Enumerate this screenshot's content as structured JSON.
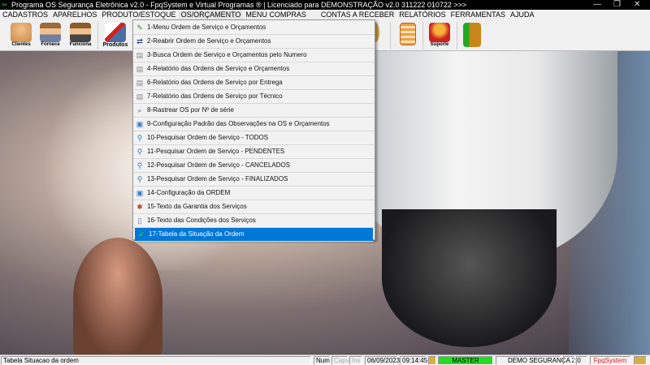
{
  "window": {
    "title": "Programa OS Segurança Eletrônica v2.0 - FpqSystem e Virtual Programas ® | Licenciado para  DEMONSTRAÇÃO v2.0 311222 010722 >>>",
    "minimize": "—",
    "maximize": "❐",
    "close": "✕"
  },
  "menubar": [
    "CADASTROS",
    "APARELHOS",
    "PRODUTO/ESTOQUE",
    "OS/ORÇAMENTO",
    "MENU COMPRAS",
    "CONTAS A RECEBER",
    "RELATÓRIOS",
    "FERRAMENTAS",
    "AJUDA"
  ],
  "toolbar": {
    "clientes": "Clientes",
    "fornece": "Fornece",
    "funciona": "Funciona",
    "produtos": "Produtos",
    "suporte": "Suporte"
  },
  "os_menu": [
    {
      "label": "1-Menu Ordem de Serviço e Orçamentos",
      "icon": "edit-check-icon"
    },
    {
      "label": "2-Reabrir Ordem de Serviço e Orçamentos",
      "icon": "swap-arrows-icon"
    },
    {
      "label": "3-Busca Ordem de Serviço e Orçamentos pelo Numero",
      "icon": "printer-icon"
    },
    {
      "label": "4-Relatório das Ordens de Serviço e Orçamentos",
      "icon": "printer-icon"
    },
    {
      "label": "6-Relatório das Ordens de Serviço por Entrega",
      "icon": "printer-icon"
    },
    {
      "label": "7-Relatório das Ordens de Serviço por Técnico",
      "icon": "printer-icon"
    },
    {
      "label": "8-Rastrear OS por Nº de série",
      "icon": "track-search-icon"
    },
    {
      "label": "9-Configuração Padrão das Observações na OS e Orçamentos",
      "icon": "config-window-icon"
    },
    {
      "label": "10-Pesquisar Ordem de Serviço - TODOS",
      "icon": "magnifier-icon"
    },
    {
      "label": "11-Pesquisar Ordem de Serviço - PENDENTES",
      "icon": "magnifier-icon"
    },
    {
      "label": "12-Pesquisar Ordem de Serviço - CANCELADOS",
      "icon": "magnifier-icon"
    },
    {
      "label": "13-Pesquisar Ordem de Serviço - FINALIZADOS",
      "icon": "magnifier-icon"
    },
    {
      "label": "14-Configuração da ORDEM",
      "icon": "config-window-icon"
    },
    {
      "label": "15-Texto da Garantia dos Serviços",
      "icon": "document-star-icon"
    },
    {
      "label": "16-Texto das Condições dos Serviços",
      "icon": "document-icon"
    },
    {
      "label": "17-Tabela da Situação da Ordem",
      "icon": "check-icon",
      "selected": true
    }
  ],
  "status": {
    "hint": "Tabela Situacao da ordem",
    "num": "Num",
    "caps": "Caps",
    "ins": "Ins",
    "date": "06/09/2023",
    "time": "09:14:45",
    "user": "MASTER",
    "company": "DEMO SEGURANCA 2.0",
    "brand": "FpqSystem"
  },
  "colors": {
    "selection": "#0078d7",
    "user_badge": "#22dd22",
    "brand": "#e02020"
  }
}
